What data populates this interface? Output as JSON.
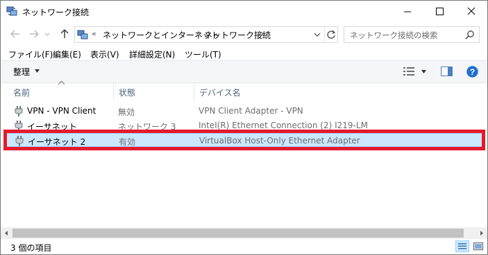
{
  "window": {
    "title": "ネットワーク接続"
  },
  "address": {
    "overflow": "«",
    "crumbs": [
      "ネットワークとインターネット",
      "ネットワーク接続"
    ],
    "separator": "›"
  },
  "search": {
    "placeholder": "ネットワーク接続の検索"
  },
  "menu": [
    "ファイル(F)",
    "編集(E)",
    "表示(V)",
    "詳細設定(N)",
    "ツール(T)"
  ],
  "toolbar": {
    "organize_label": "整理"
  },
  "columns": {
    "name": "名前",
    "status": "状態",
    "device": "デバイス名"
  },
  "rows": [
    {
      "name": "VPN - VPN Client",
      "status": "無効",
      "device": "VPN Client Adapter - VPN",
      "selected": false
    },
    {
      "name": "イーサネット",
      "status": "ネットワーク 3",
      "device": "Intel(R) Ethernet Connection (2) I219-LM",
      "selected": false
    },
    {
      "name": "イーサネット 2",
      "status": "有効",
      "device": "VirtualBox Host-Only Ethernet Adapter",
      "selected": true
    }
  ],
  "status_bar": {
    "item_count": "3 個の項目"
  },
  "colors": {
    "selection": "#cce8ff",
    "highlight": "#e8192c",
    "help": "#1f6fd0"
  },
  "icons": [
    "network-connections-icon",
    "back-arrow-icon",
    "forward-arrow-icon",
    "up-arrow-icon",
    "refresh-icon",
    "search-icon",
    "network-adapter-icon",
    "help-icon"
  ]
}
